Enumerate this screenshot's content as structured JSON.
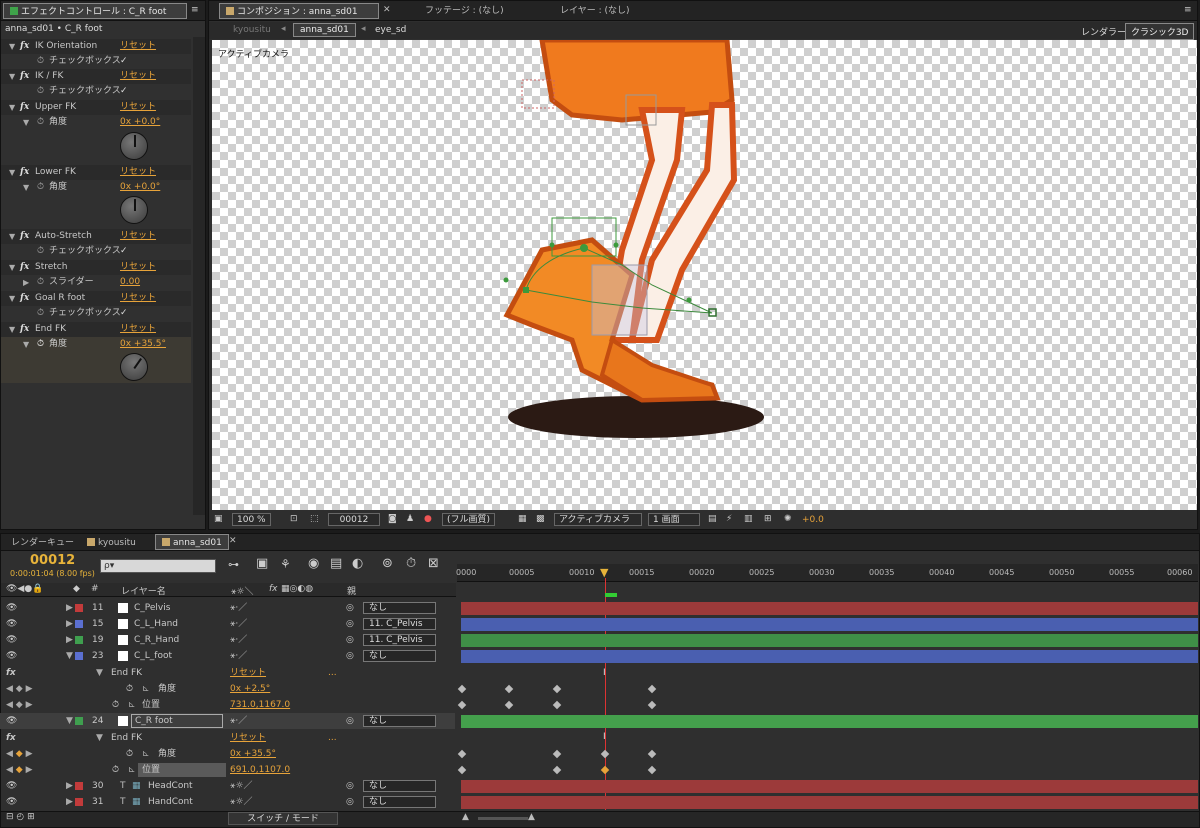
{
  "effects_panel": {
    "tab": "エフェクトコントロール : C_R foot",
    "breadcrumb": "anna_sd01 • C_R foot",
    "effects": [
      {
        "name": "IK Orientation",
        "reset": "リセット",
        "param": "チェックボックス",
        "value": "✓"
      },
      {
        "name": "IK / FK",
        "reset": "リセット",
        "param": "チェックボックス",
        "value": "✓"
      },
      {
        "name": "Upper FK",
        "reset": "リセット",
        "param": "角度",
        "value": "0x +0.0°"
      },
      {
        "name": "Lower FK",
        "reset": "リセット",
        "param": "角度",
        "value": "0x +0.0°"
      },
      {
        "name": "Auto-Stretch",
        "reset": "リセット",
        "param": "チェックボックス",
        "value": "✓"
      },
      {
        "name": "Stretch",
        "reset": "リセット",
        "param": "スライダー",
        "value": "0.00"
      },
      {
        "name": "Goal R foot",
        "reset": "リセット",
        "param": "チェックボックス",
        "value": "✓"
      },
      {
        "name": "End FK",
        "reset": "リセット",
        "param": "角度",
        "value": "0x +35.5°"
      }
    ]
  },
  "viewer": {
    "tabs": [
      "コンポジション : anna_sd01",
      "フッテージ : (なし)",
      "レイヤー : (なし)"
    ],
    "nav": [
      "kyousitu",
      "anna_sd01",
      "eye_sd"
    ],
    "renderer_label": "レンダラー :",
    "renderer_value": "クラシック3D",
    "camera_label": "アクティブカメラ",
    "zoom": "100 %",
    "timecode": "00012",
    "quality": "(フル画質)",
    "camera_select": "アクティブカメラ",
    "views": "1 画面",
    "exposure": "+0.0"
  },
  "timeline": {
    "tabs": [
      "レンダーキュー",
      "kyousitu",
      "anna_sd01"
    ],
    "timecode": "00012",
    "timecode_sub": "0:00:01:04 (8.00 fps)",
    "search_placeholder": "ρ▾",
    "col_num": "#",
    "col_name": "レイヤー名",
    "col_parent": "親",
    "ruler": [
      "0000",
      "00005",
      "00010",
      "00015",
      "00020",
      "00025",
      "00030",
      "00035",
      "00040",
      "00045",
      "00050",
      "00055",
      "00060"
    ],
    "layers": [
      {
        "num": "11",
        "name": "C_Pelvis",
        "color": "#c23b3b",
        "parent": "なし"
      },
      {
        "num": "15",
        "name": "C_L_Hand",
        "color": "#5b6fd0",
        "parent": "11. C_Pelvis"
      },
      {
        "num": "19",
        "name": "C_R_Hand",
        "color": "#3f9f4f",
        "parent": "11. C_Pelvis"
      },
      {
        "num": "23",
        "name": "C_L_foot",
        "color": "#5b6fd0",
        "parent": "なし"
      }
    ],
    "layer23_fx": {
      "label": "End FK",
      "reset": "リセット",
      "dots": "...",
      "angle_label": "角度",
      "angle_value": "0x +2.5°",
      "pos_label": "位置",
      "pos_value": "731.0,1167.0"
    },
    "layer24": {
      "num": "24",
      "name": "C_R foot",
      "color": "#3f9f4f",
      "parent": "なし"
    },
    "layer24_fx": {
      "label": "End FK",
      "reset": "リセット",
      "dots": "...",
      "angle_label": "角度",
      "angle_value": "0x +35.5°",
      "pos_label": "位置",
      "pos_value": "691.0,1107.0"
    },
    "layers_bottom": [
      {
        "num": "30",
        "name": "HeadCont",
        "color": "#c23b3b",
        "parent": "なし"
      },
      {
        "num": "31",
        "name": "HandCont",
        "color": "#c23b3b",
        "parent": "なし"
      }
    ],
    "switch_mode": "スイッチ / モード",
    "fx_symbol": "fx",
    "colors": {
      "red": "#9c3a3a",
      "blue": "#4a5fb0",
      "green": "#3f8f47"
    }
  }
}
